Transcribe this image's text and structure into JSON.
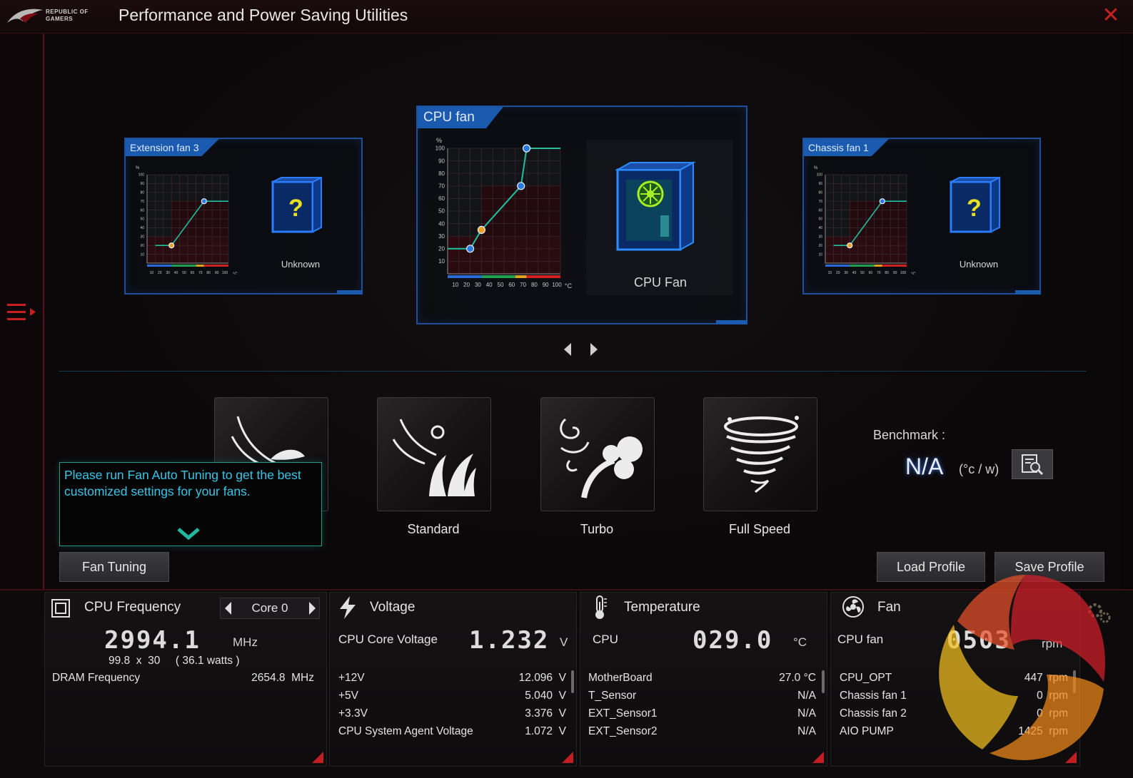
{
  "app": {
    "logo_text_line1": "REPUBLIC OF",
    "logo_text_line2": "GAMERS",
    "title": "Performance and Power Saving Utilities"
  },
  "colors": {
    "accent_red": "#c8201e",
    "card_blue": "#1a5bb0",
    "tooltip_cyan": "#38c6e8"
  },
  "fan_cards": {
    "left": {
      "tab": "Extension fan 3",
      "caption": "Unknown",
      "icon": "unknown-case-icon"
    },
    "center": {
      "tab": "CPU fan",
      "caption": "CPU Fan",
      "icon": "cpu-fan-case-icon"
    },
    "right": {
      "tab": "Chassis fan 1",
      "caption": "Unknown",
      "icon": "unknown-case-icon"
    }
  },
  "chart": {
    "y_unit": "%",
    "x_unit": "°C",
    "y_ticks": [
      "100",
      "90",
      "80",
      "70",
      "60",
      "50",
      "40",
      "30",
      "20",
      "10"
    ],
    "x_ticks": [
      "10",
      "20",
      "30",
      "40",
      "50",
      "60",
      "70",
      "80",
      "90",
      "100"
    ],
    "unknown_mark": "?"
  },
  "chart_data": [
    {
      "type": "line",
      "title": "Extension fan 3",
      "xlabel": "°C",
      "ylabel": "%",
      "x": [
        10,
        30,
        70,
        100
      ],
      "y": [
        20,
        20,
        70,
        70
      ],
      "xlim": [
        0,
        100
      ],
      "ylim": [
        0,
        100
      ]
    },
    {
      "type": "line",
      "title": "CPU fan",
      "xlabel": "°C",
      "ylabel": "%",
      "x": [
        0,
        20,
        30,
        65,
        70,
        100
      ],
      "y": [
        20,
        20,
        35,
        70,
        100,
        100
      ],
      "xlim": [
        0,
        100
      ],
      "ylim": [
        0,
        100
      ]
    },
    {
      "type": "line",
      "title": "Chassis fan 1",
      "xlabel": "°C",
      "ylabel": "%",
      "x": [
        10,
        30,
        70,
        100
      ],
      "y": [
        20,
        20,
        70,
        70
      ],
      "xlim": [
        0,
        100
      ],
      "ylim": [
        0,
        100
      ]
    }
  ],
  "modes": [
    {
      "label": "",
      "icon": "silent-mode-icon"
    },
    {
      "label": "Standard",
      "icon": "standard-mode-icon"
    },
    {
      "label": "Turbo",
      "icon": "turbo-mode-icon"
    },
    {
      "label": "Full Speed",
      "icon": "full-speed-mode-icon"
    }
  ],
  "benchmark": {
    "label": "Benchmark :",
    "value": "N/A",
    "unit": "(°c / w)"
  },
  "tooltip": {
    "text": "Please run Fan Auto Tuning to get the best customized settings for your fans."
  },
  "buttons": {
    "fan_tuning": "Fan Tuning",
    "load_profile": "Load Profile",
    "save_profile": "Save Profile"
  },
  "monitor": {
    "cpu": {
      "title": "CPU Frequency",
      "core_select": "Core 0",
      "freq": "2994.1",
      "freq_unit": "MHz",
      "detail": "99.8  x  30     ( 36.1 watts )",
      "dram_label": "DRAM Frequency",
      "dram_value": "2654.8  MHz"
    },
    "voltage": {
      "title": "Voltage",
      "main_label": "CPU Core Voltage",
      "main_value": "1.232",
      "main_unit": "V",
      "rows": [
        {
          "label": "+12V",
          "value": "12.096  V"
        },
        {
          "label": "+5V",
          "value": "5.040  V"
        },
        {
          "label": "+3.3V",
          "value": "3.376  V"
        },
        {
          "label": "CPU System Agent Voltage",
          "value": "1.072  V"
        }
      ]
    },
    "temperature": {
      "title": "Temperature",
      "main_label": "CPU",
      "main_value": "029.0",
      "main_unit": "°C",
      "rows": [
        {
          "label": "MotherBoard",
          "value": "27.0 °C"
        },
        {
          "label": "T_Sensor",
          "value": "N/A"
        },
        {
          "label": "EXT_Sensor1",
          "value": "N/A"
        },
        {
          "label": "EXT_Sensor2",
          "value": "N/A"
        }
      ]
    },
    "fan": {
      "title": "Fan",
      "main_label": "CPU fan",
      "main_value": "0503",
      "main_unit": "rpm",
      "rows": [
        {
          "label": "CPU_OPT",
          "value": "447  rpm"
        },
        {
          "label": "Chassis fan 1",
          "value": "0  rpm"
        },
        {
          "label": "Chassis fan 2",
          "value": "0  rpm"
        },
        {
          "label": "AIO PUMP",
          "value": "1425  rpm"
        }
      ]
    }
  }
}
